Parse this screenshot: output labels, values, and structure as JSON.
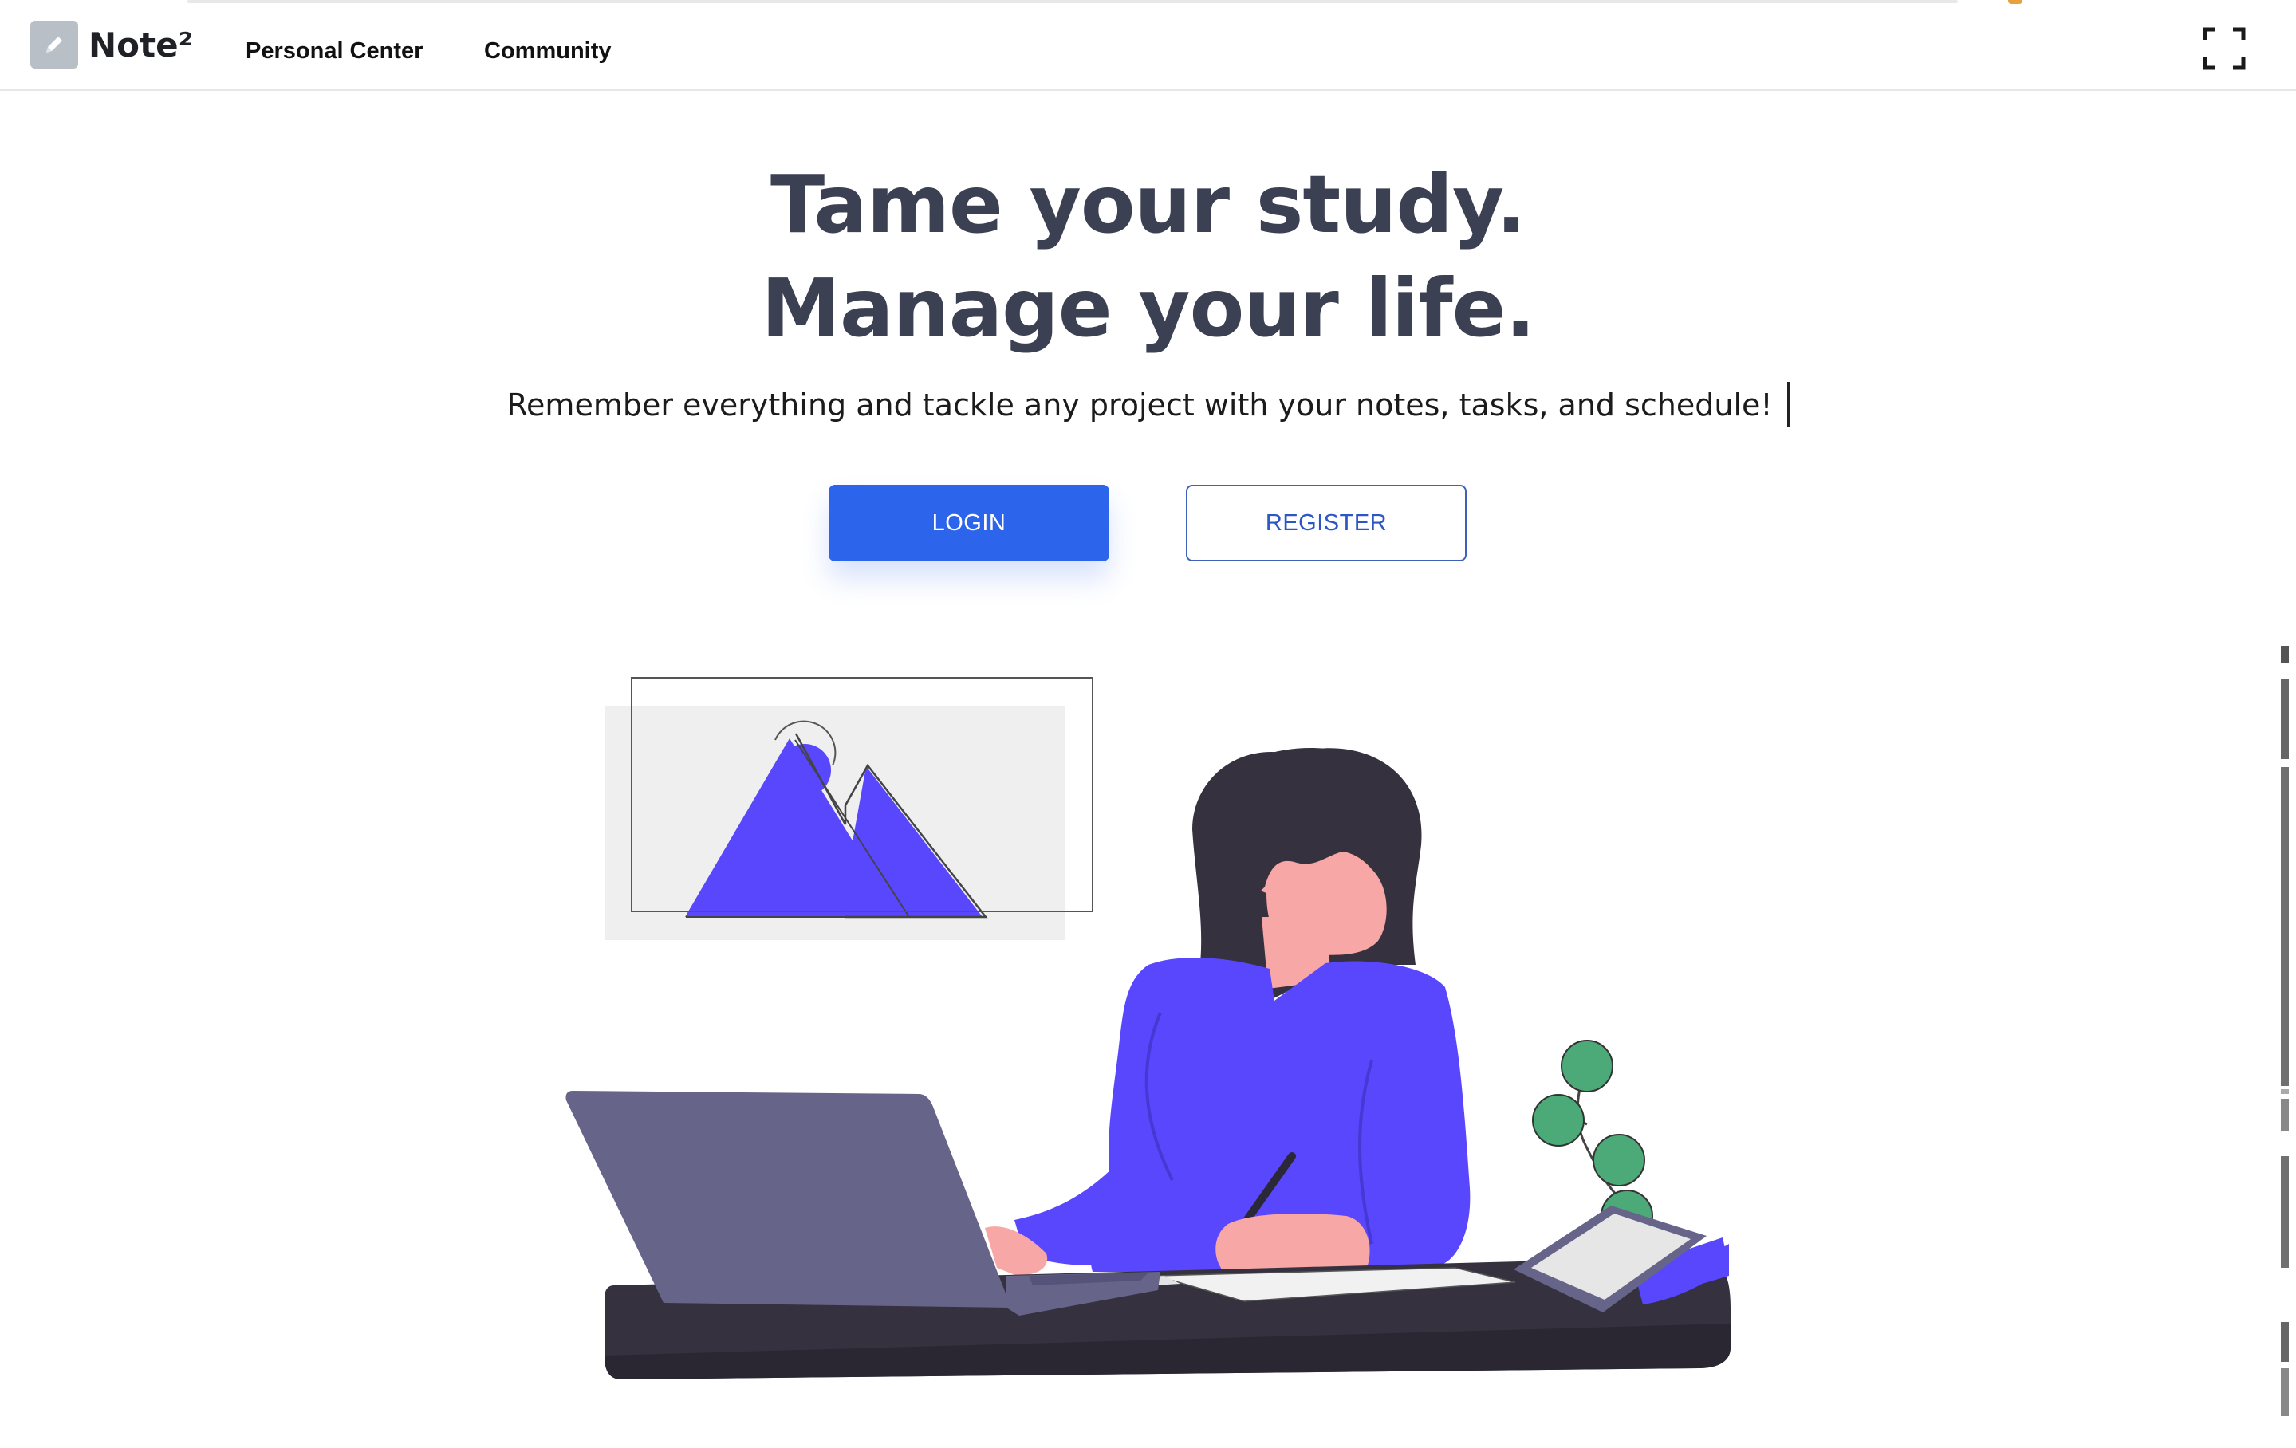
{
  "app": {
    "brand": "Note²"
  },
  "nav": {
    "items": [
      {
        "label": "Personal Center"
      },
      {
        "label": "Community"
      }
    ],
    "fullscreen_icon": "fullscreen-icon"
  },
  "hero": {
    "title_line1": "Tame your study.",
    "title_line2": "Manage your life.",
    "subtitle": "Remember everything and tackle any project with your notes, tasks, and schedule!"
  },
  "actions": {
    "login_label": "LOGIN",
    "register_label": "REGISTER"
  },
  "colors": {
    "primary": "#2c64ec",
    "title": "#3b4052",
    "illustration_accent": "#5847fd",
    "desk": "#35313f",
    "laptop": "#67648a",
    "plant": "#4caa78"
  }
}
